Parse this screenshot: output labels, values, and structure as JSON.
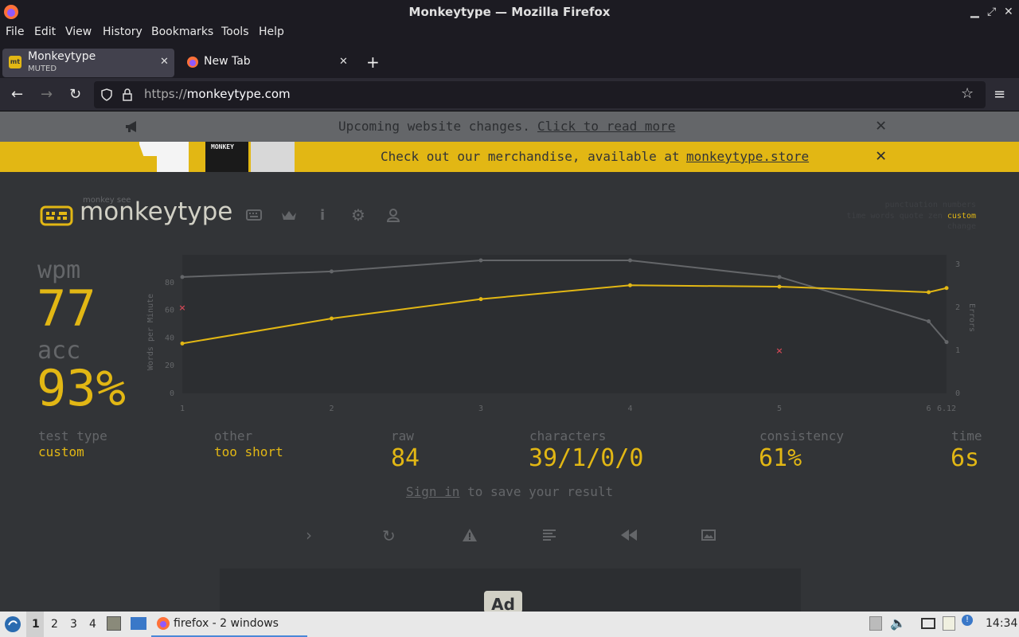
{
  "window": {
    "title": "Monkeytype — Mozilla Firefox"
  },
  "menu": {
    "items": [
      "File",
      "Edit",
      "View",
      "History",
      "Bookmarks",
      "Tools",
      "Help"
    ]
  },
  "tabs": [
    {
      "title": "Monkeytype",
      "subtitle": "MUTED",
      "favicon": "mt"
    },
    {
      "title": "New Tab",
      "subtitle": ""
    }
  ],
  "address": {
    "url_prefix": "https://",
    "url_host": "monkeytype.com"
  },
  "notice": {
    "text": "Upcoming website changes.",
    "link": "Click to read more"
  },
  "merch": {
    "text": "Check out our merchandise, available at",
    "link": "monkeytype.store",
    "shirt_text": "MONKEY"
  },
  "header": {
    "logo_small": "monkey see",
    "logo": "monkeytype",
    "config_row1": "punctuation numbers",
    "config_row2_modes": "time words quote zen",
    "config_row2_active": "custom",
    "config_row3": "change"
  },
  "results": {
    "wpm_label": "wpm",
    "wpm": "77",
    "acc_label": "acc",
    "acc": "93%",
    "test_type_label": "test type",
    "test_type": "custom",
    "other_label": "other",
    "other": "too short",
    "raw_label": "raw",
    "raw": "84",
    "characters_label": "characters",
    "characters": "39/1/0/0",
    "consistency_label": "consistency",
    "consistency": "61%",
    "time_label": "time",
    "time": "6s",
    "signin_link": "Sign in",
    "signin_text": "to save your result",
    "ad_text": "Ad"
  },
  "chart_data": {
    "type": "line",
    "x": [
      1,
      2,
      3,
      4,
      5,
      6,
      6.12
    ],
    "x_tick_labels": [
      "1",
      "2",
      "3",
      "4",
      "5",
      "6",
      "6.12"
    ],
    "ylabel": "Words per Minute",
    "y2label": "Errors",
    "ylim": [
      0,
      100
    ],
    "y_ticks": [
      "0",
      "20",
      "40",
      "60",
      "80"
    ],
    "y2lim": [
      0,
      3
    ],
    "y2_ticks": [
      "0",
      "1",
      "2",
      "3"
    ],
    "series": [
      {
        "name": "wpm",
        "color": "#e2b714",
        "values": [
          36,
          54,
          68,
          78,
          77,
          73,
          76
        ]
      },
      {
        "name": "raw",
        "color": "#646669",
        "values": [
          84,
          88,
          96,
          96,
          84,
          52,
          37
        ]
      }
    ],
    "errors": {
      "color": "#ca4754",
      "points": [
        {
          "x": 1,
          "y": 2
        },
        {
          "x": 5,
          "y": 1
        }
      ]
    }
  },
  "taskbar": {
    "workspaces": [
      "1",
      "2",
      "3",
      "4"
    ],
    "task": "firefox - 2 windows",
    "clock": "14:34"
  }
}
